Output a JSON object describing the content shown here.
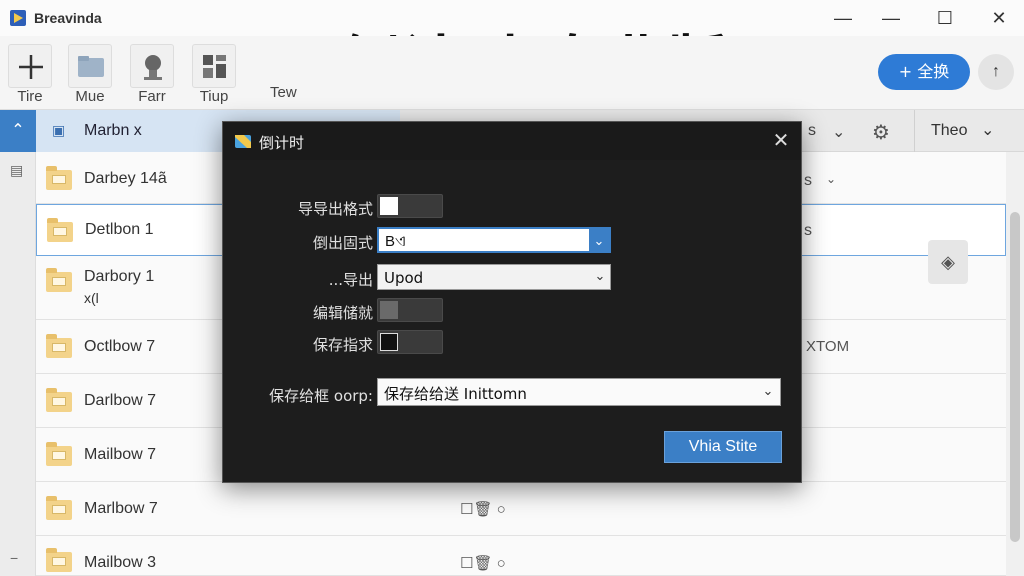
{
  "window": {
    "app_title": "Breavinda",
    "big_title": "倒计时 专业版",
    "minimize": "—",
    "maximize": "☐",
    "close": "✕"
  },
  "toolbar": {
    "items": [
      {
        "label": "Tire",
        "icon": "plus-icon"
      },
      {
        "label": "Mue",
        "icon": "folder-icon"
      },
      {
        "label": "Farr",
        "icon": "pin-icon"
      },
      {
        "label": "Tiup",
        "icon": "grid-icon"
      }
    ],
    "extra_label": "Tew",
    "new_button": "+ 全换",
    "round_button": "↑"
  },
  "header": {
    "selected_column": "Marbn x",
    "fragments": [
      "Theo"
    ],
    "gear": "⚙",
    "theme_chevron": "⌄"
  },
  "rows": [
    {
      "name": "Darbey 14ã"
    },
    {
      "name": "Detlbon 1"
    },
    {
      "name": "Darbory 1",
      "sub": "x(l"
    },
    {
      "name": "Octlbow 7",
      "right": "XTOM"
    },
    {
      "name": "Darlbow 7"
    },
    {
      "name": "Mailbow 7"
    },
    {
      "name": "Marlbow 7"
    },
    {
      "name": "Mailbow 3"
    }
  ],
  "side_text": {
    "s1": "s",
    "s2": "s"
  },
  "dialog": {
    "title": "倒计时",
    "close": "✕",
    "fields": {
      "export_format_label": "导导出格式",
      "export_dir_label": "倒出固式",
      "export_dir_value": "Bଏ",
      "export_label": "...导出",
      "export_value": "Upod",
      "record_label": "编辑储就",
      "save_label": "保存指求",
      "save_group_label": "保存给框 oorp:",
      "save_group_value": "保存给给送 Inittomn"
    },
    "primary_button": "Vhia Stite"
  },
  "colors": {
    "accent": "#3b7fc6",
    "dialog_bg": "#1d1d1d"
  }
}
